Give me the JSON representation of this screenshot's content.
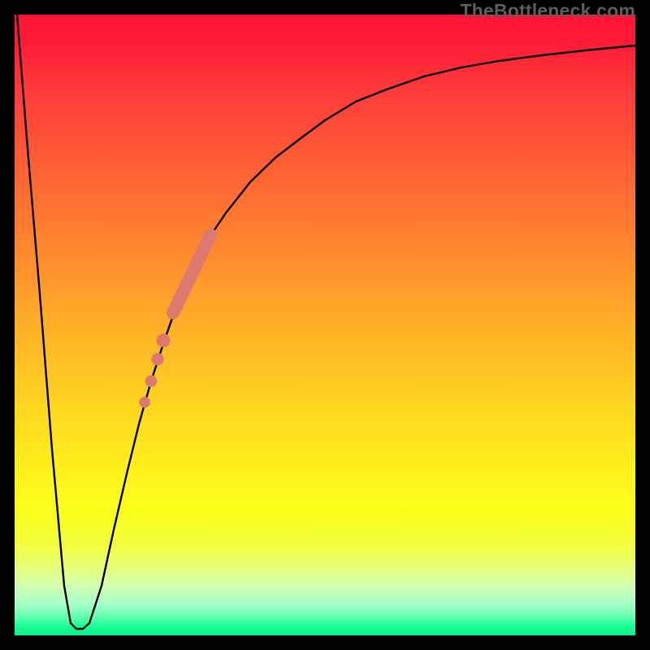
{
  "watermark": "TheBottleneck.com",
  "chart_data": {
    "type": "line",
    "title": "",
    "xlabel": "",
    "ylabel": "",
    "xlim": [
      0,
      100
    ],
    "ylim": [
      0,
      100
    ],
    "gradient_stops": [
      {
        "pos": 0,
        "color": "#ff1435"
      },
      {
        "pos": 12,
        "color": "#ff3a3a"
      },
      {
        "pos": 28,
        "color": "#ff6a32"
      },
      {
        "pos": 40,
        "color": "#ff8f2c"
      },
      {
        "pos": 52,
        "color": "#ffb526"
      },
      {
        "pos": 64,
        "color": "#ffd820"
      },
      {
        "pos": 74,
        "color": "#fff21a"
      },
      {
        "pos": 85,
        "color": "#f3ff3a"
      },
      {
        "pos": 92,
        "color": "#d1ffb0"
      },
      {
        "pos": 97,
        "color": "#63ffb0"
      },
      {
        "pos": 100,
        "color": "#09f08a"
      }
    ],
    "series": [
      {
        "name": "bottleneck-curve",
        "x": [
          0.5,
          2,
          4,
          6,
          8,
          9,
          10,
          11,
          12,
          14,
          16,
          18,
          20,
          22,
          24,
          26,
          28,
          30,
          34,
          38,
          42,
          46,
          50,
          55,
          60,
          66,
          72,
          78,
          85,
          92,
          100
        ],
        "y": [
          100,
          80,
          55,
          30,
          8,
          2,
          1,
          1,
          2,
          8,
          17,
          26,
          34,
          41,
          47,
          53,
          58,
          62,
          68,
          73,
          77,
          80,
          83,
          86,
          88,
          90,
          91.5,
          92.5,
          93.5,
          94.3,
          95
        ]
      }
    ],
    "markers": [
      {
        "segment": {
          "x1": 25.5,
          "y1": 52.0,
          "x2": 31.5,
          "y2": 64.5
        },
        "width": 4.2
      },
      {
        "point": {
          "x": 24.0,
          "y": 47.5
        },
        "r": 2.2
      },
      {
        "point": {
          "x": 23.0,
          "y": 44.5
        },
        "r": 2.0
      },
      {
        "point": {
          "x": 22.0,
          "y": 41.0
        },
        "r": 1.9
      },
      {
        "point": {
          "x": 21.0,
          "y": 37.5
        },
        "r": 1.8
      }
    ],
    "background_meaning": "gradient from red (high bottleneck) at top to green (optimal) at bottom"
  }
}
